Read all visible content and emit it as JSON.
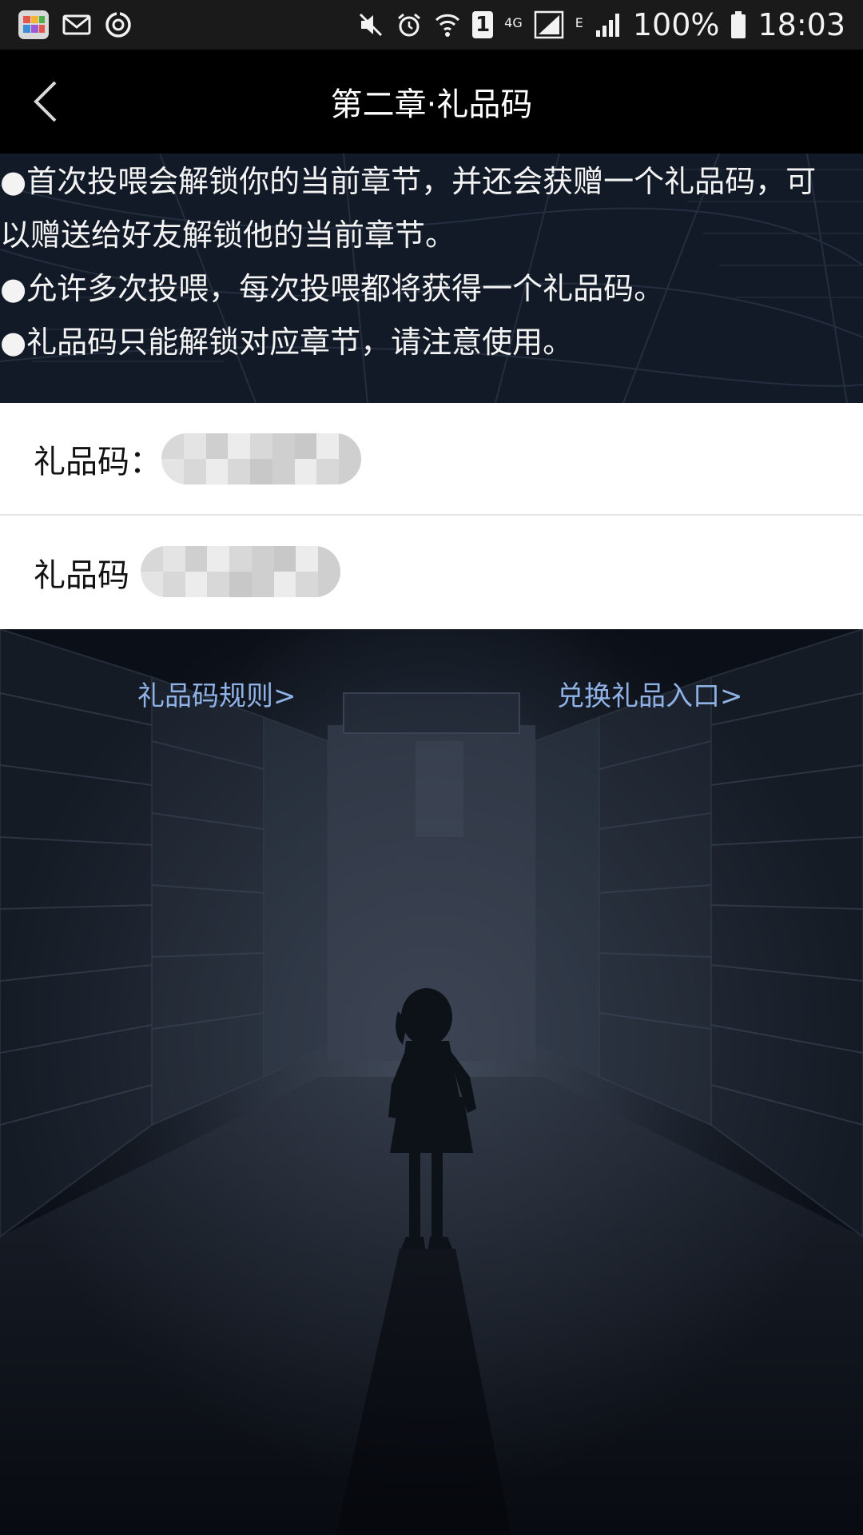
{
  "status_bar": {
    "notification_icons": [
      "app-grid-icon",
      "mail-icon",
      "sync-icon"
    ],
    "system_icons": [
      "mute-icon",
      "alarm-icon",
      "wifi-icon",
      "sim1-icon",
      "signal-4g-icon",
      "signal-e-icon",
      "battery-icon"
    ],
    "network_4g": "4G",
    "network_e": "E",
    "sim_label": "1",
    "battery": "100%",
    "time": "18:03"
  },
  "nav": {
    "title": "第二章·礼品码",
    "back_icon": "chevron-left-icon"
  },
  "rules": [
    "●首次投喂会解锁你的当前章节，并还会获赠一个礼品码，可",
    "以赠送给好友解锁他的当前章节。",
    "●允许多次投喂，每次投喂都将获得一个礼品码。",
    "●礼品码只能解锁对应章节，请注意使用。"
  ],
  "codes": [
    {
      "label": "礼品码："
    },
    {
      "label": "礼品码"
    }
  ],
  "links": {
    "rules": "礼品码规则>",
    "redeem": "兑换礼品入口>"
  },
  "colors": {
    "link": "#8fb2e6",
    "nav_background": "#000000",
    "card_background": "#ffffff"
  }
}
